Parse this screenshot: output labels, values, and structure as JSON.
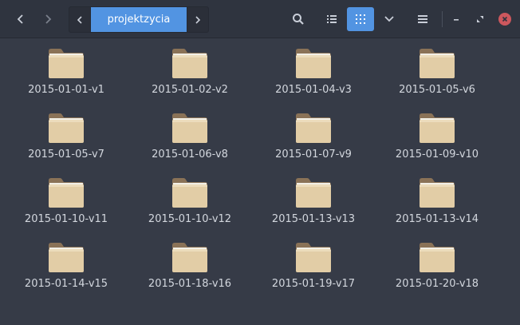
{
  "toolbar": {
    "back_icon": "chevron-left-icon",
    "forward_icon": "chevron-right-icon",
    "path": {
      "current": "projektzycia"
    },
    "search_icon": "search-icon",
    "list_view_icon": "list-view-icon",
    "grid_view_icon": "grid-view-icon",
    "view_options_icon": "chevron-down-icon",
    "menu_icon": "hamburger-menu-icon",
    "active_color": "#5294e2"
  },
  "window_controls": {
    "minimize_icon": "minimize-icon",
    "maximize_icon": "maximize-icon",
    "close_icon": "close-icon",
    "close_color": "#cc575d"
  },
  "folders": [
    {
      "name": "2015-01-01-v1"
    },
    {
      "name": "2015-01-02-v2"
    },
    {
      "name": "2015-01-04-v3"
    },
    {
      "name": "2015-01-05-v6"
    },
    {
      "name": "2015-01-05-v7"
    },
    {
      "name": "2015-01-06-v8"
    },
    {
      "name": "2015-01-07-v9"
    },
    {
      "name": "2015-01-09-v10"
    },
    {
      "name": "2015-01-10-v11"
    },
    {
      "name": "2015-01-10-v12"
    },
    {
      "name": "2015-01-13-v13"
    },
    {
      "name": "2015-01-13-v14"
    },
    {
      "name": "2015-01-14-v15"
    },
    {
      "name": "2015-01-18-v16"
    },
    {
      "name": "2015-01-19-v17"
    },
    {
      "name": "2015-01-20-v18"
    }
  ]
}
